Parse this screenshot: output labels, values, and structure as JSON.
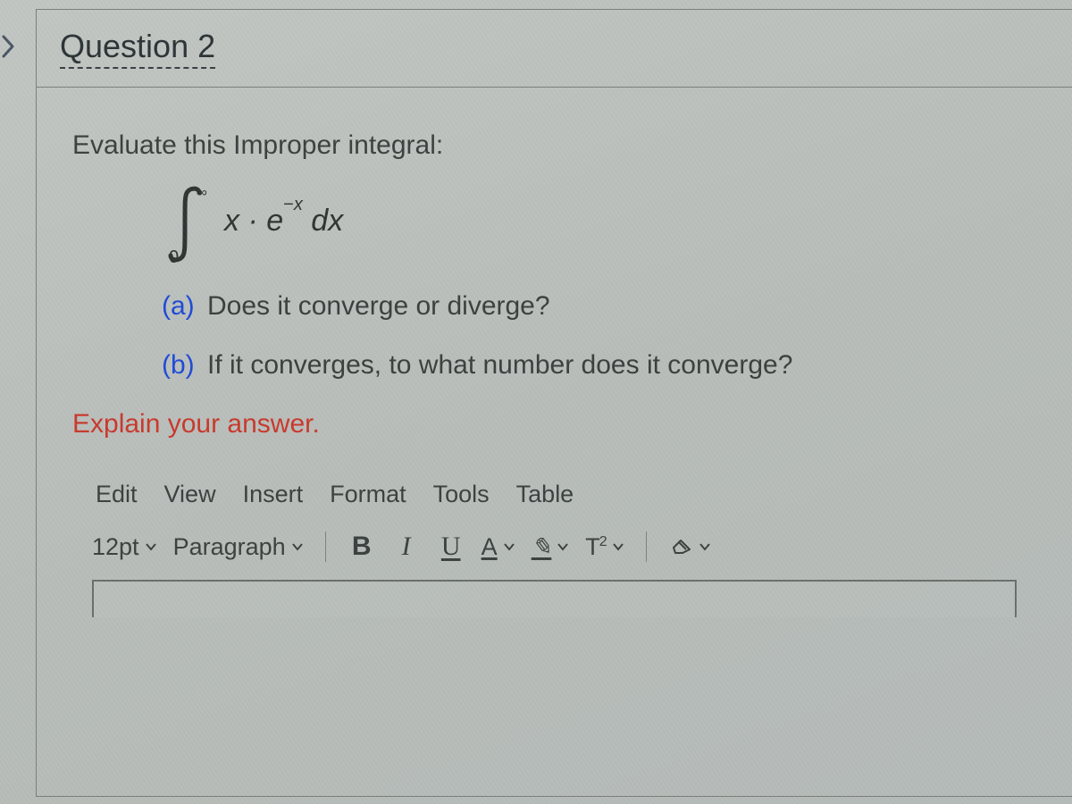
{
  "question": {
    "title": "Question 2",
    "prompt": "Evaluate this Improper integral:",
    "integral": {
      "lower": "0",
      "upper": "∞",
      "expression_html": "x · e<sup>−x</sup> dx"
    },
    "parts": [
      {
        "letter": "(a)",
        "text": "Does it converge or diverge?"
      },
      {
        "letter": "(b)",
        "text": "If it converges, to what number does it converge?"
      }
    ],
    "explain": "Explain your answer."
  },
  "editor": {
    "menus": [
      "Edit",
      "View",
      "Insert",
      "Format",
      "Tools",
      "Table"
    ],
    "font_size": "12pt",
    "block_style": "Paragraph",
    "buttons": {
      "bold": "B",
      "italic": "I",
      "underline": "U",
      "text_color": "A",
      "highlight": "✎",
      "superscript": "T²",
      "clear": "⌫"
    }
  }
}
